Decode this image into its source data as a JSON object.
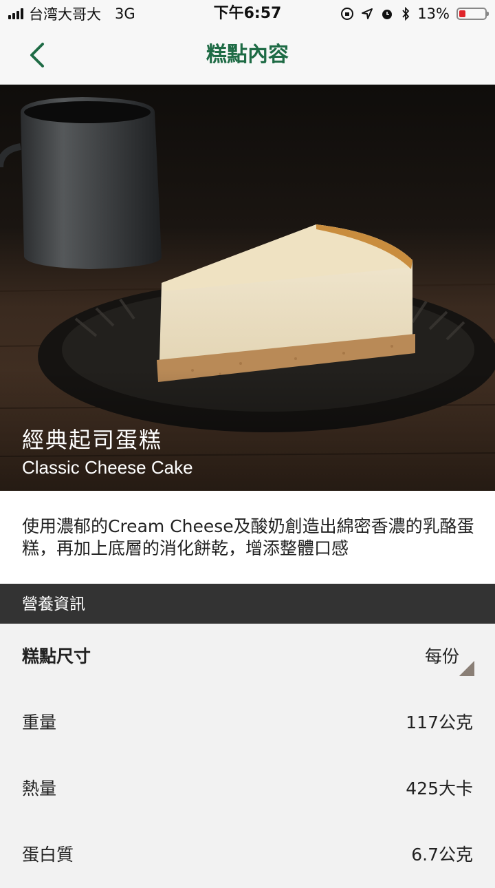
{
  "status_bar": {
    "carrier": "台湾大哥大",
    "network": "3G",
    "time": "下午6:57",
    "battery_percent": "13%",
    "battery_level": 0.13,
    "battery_color": "#e0242a"
  },
  "nav": {
    "title": "糕點內容",
    "back_icon": "chevron-left-icon",
    "accent_color": "#1e6b45"
  },
  "product": {
    "name_zh": "經典起司蛋糕",
    "name_en": "Classic Cheese Cake",
    "description": "使用濃郁的Cream Cheese及酸奶創造出綿密香濃的乳酪蛋糕，再加上底層的消化餅乾，增添整體口感"
  },
  "nutrition": {
    "section_title": "營養資訊",
    "size_label": "糕點尺寸",
    "size_value": "每份",
    "rows": [
      {
        "label": "重量",
        "value": "117公克"
      },
      {
        "label": "熱量",
        "value": "425大卡"
      },
      {
        "label": "蛋白質",
        "value": "6.7公克"
      }
    ]
  }
}
